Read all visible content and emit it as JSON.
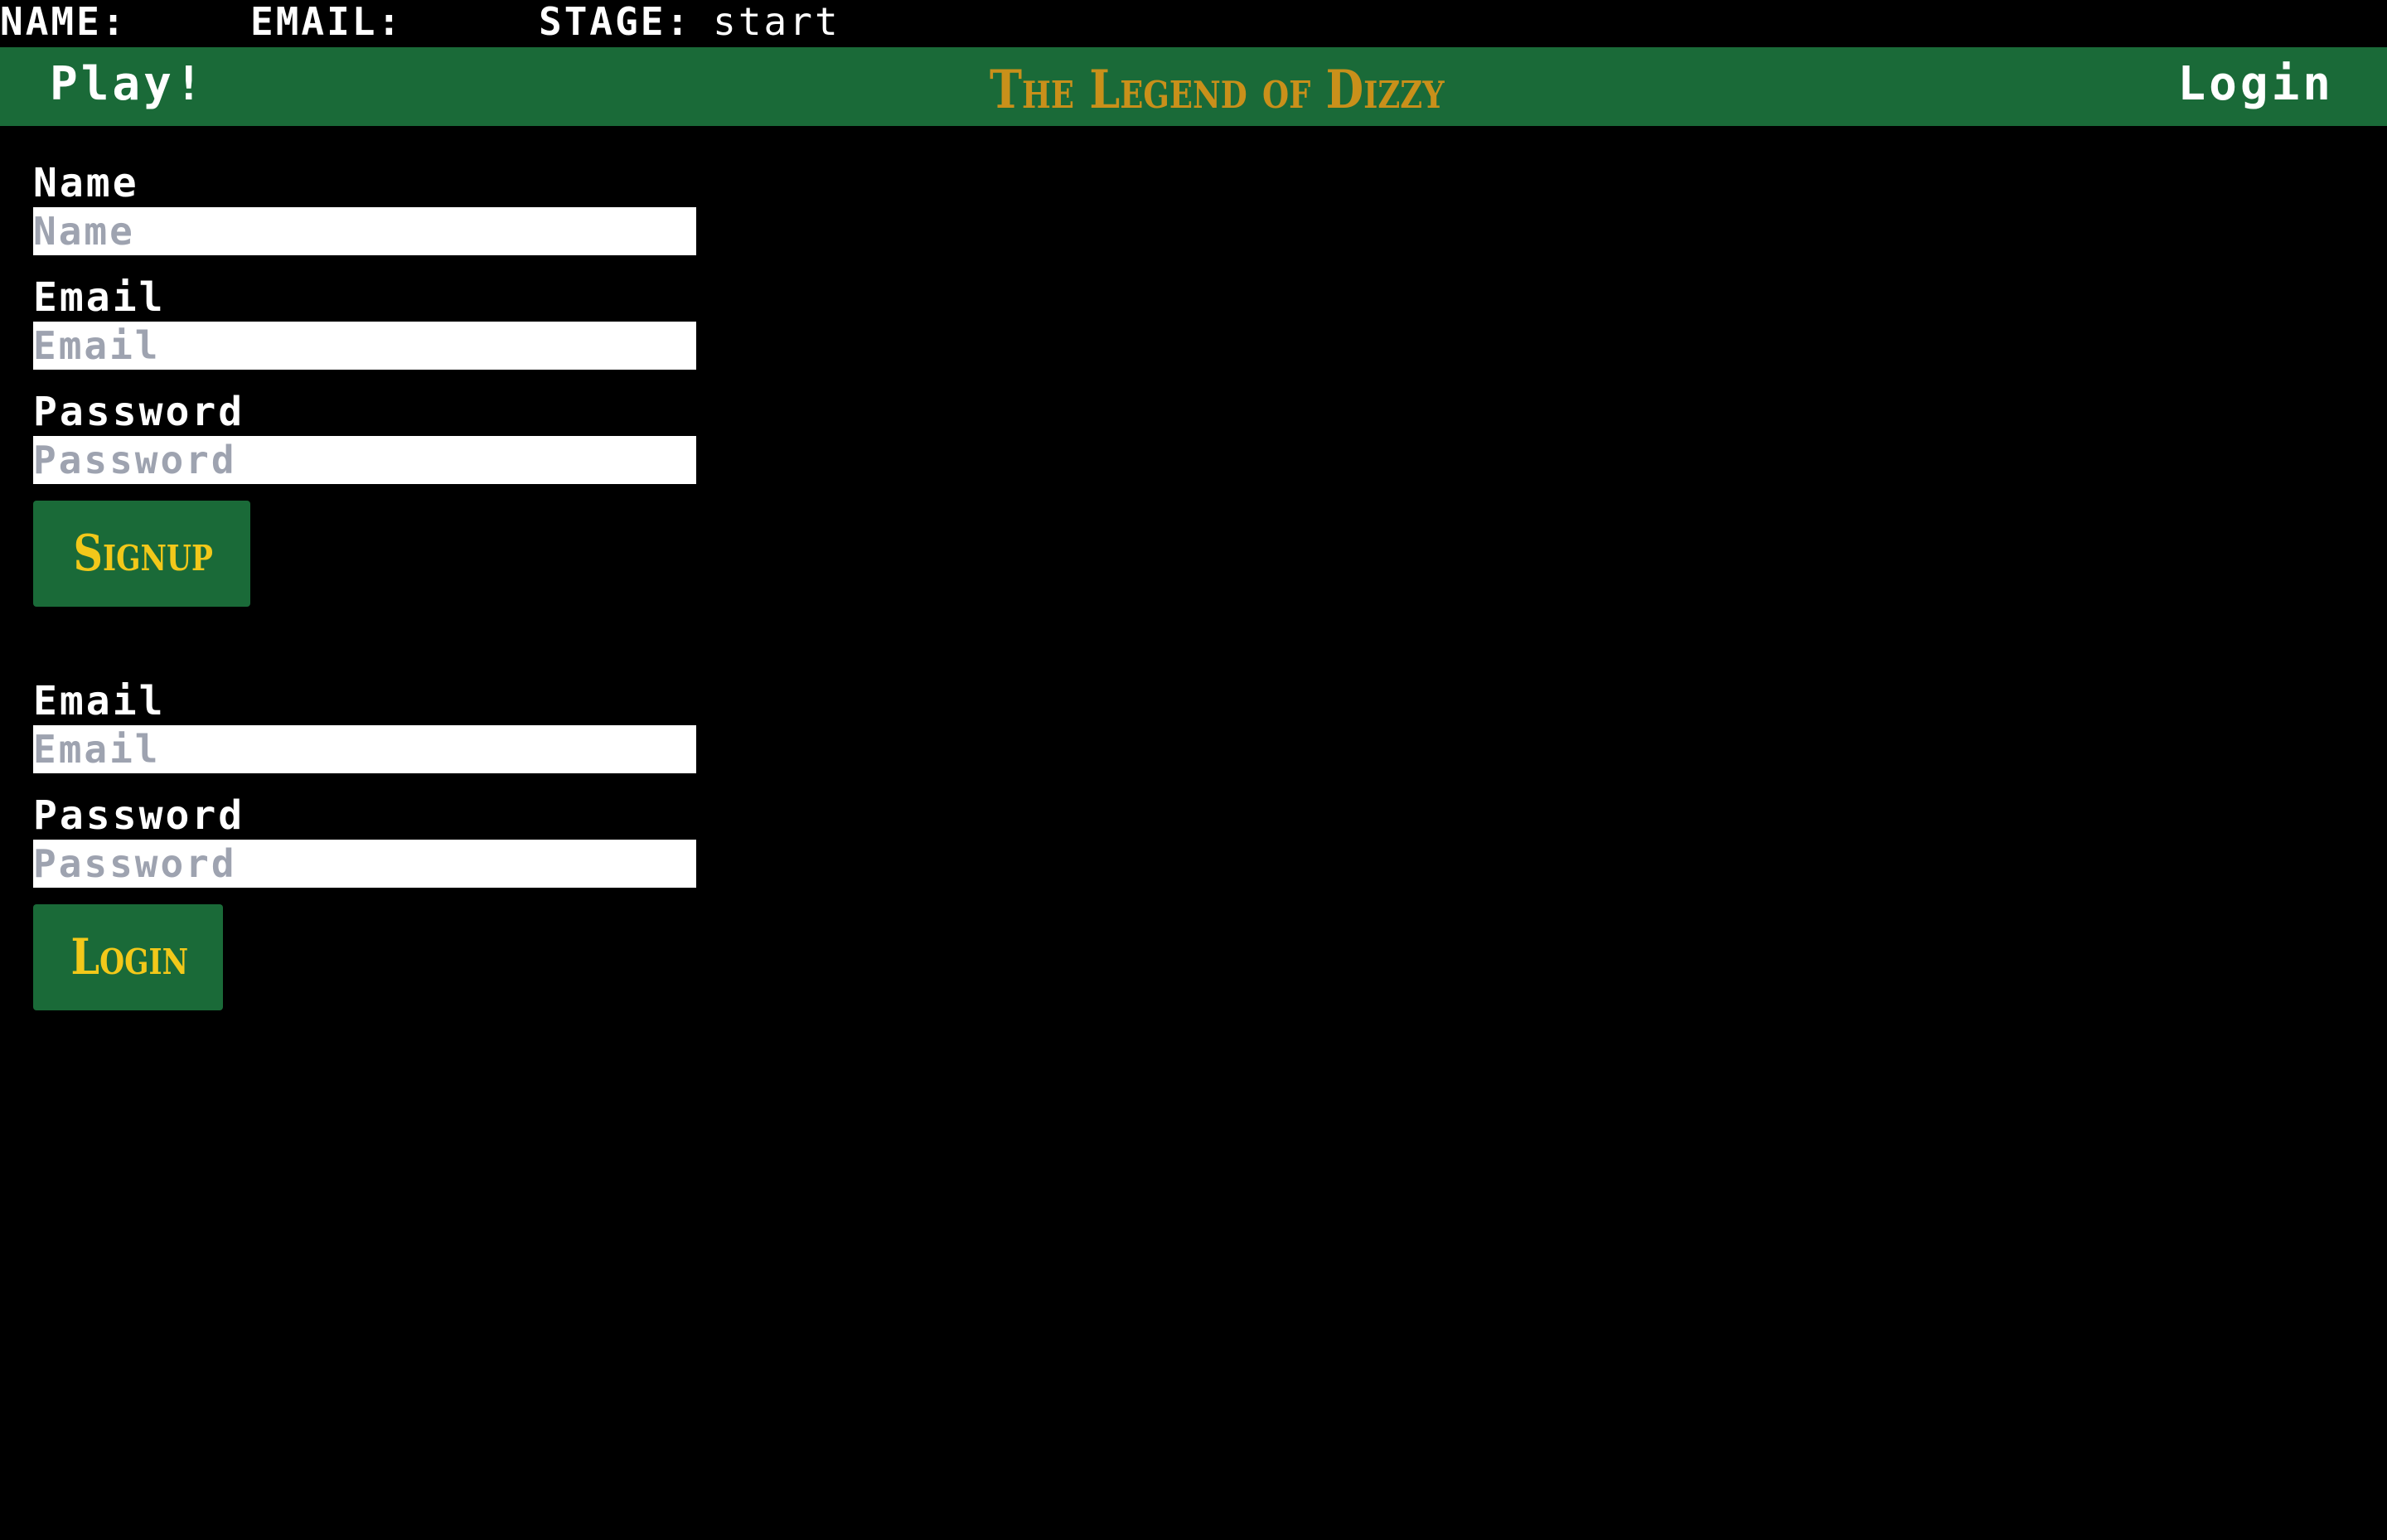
{
  "status_bar": {
    "name_label": "NAME:",
    "email_label": "EMAIL:",
    "stage_label": "STAGE:",
    "stage_value": "start"
  },
  "navbar": {
    "play_label": "Play!",
    "title": "The Legend of Dizzy",
    "login_label": "Login"
  },
  "signup_form": {
    "name_label": "Name",
    "name_placeholder": "Name",
    "email_label": "Email",
    "email_placeholder": "Email",
    "password_label": "Password",
    "password_placeholder": "Password",
    "submit_label": "Signup"
  },
  "login_form": {
    "email_label": "Email",
    "email_placeholder": "Email",
    "password_label": "Password",
    "password_placeholder": "Password",
    "submit_label": "Login"
  },
  "colors": {
    "background": "#000000",
    "navbar": "#1a6a38",
    "title": "#c9901a",
    "button_text": "#f2c81a",
    "placeholder": "#9ea3b0"
  }
}
